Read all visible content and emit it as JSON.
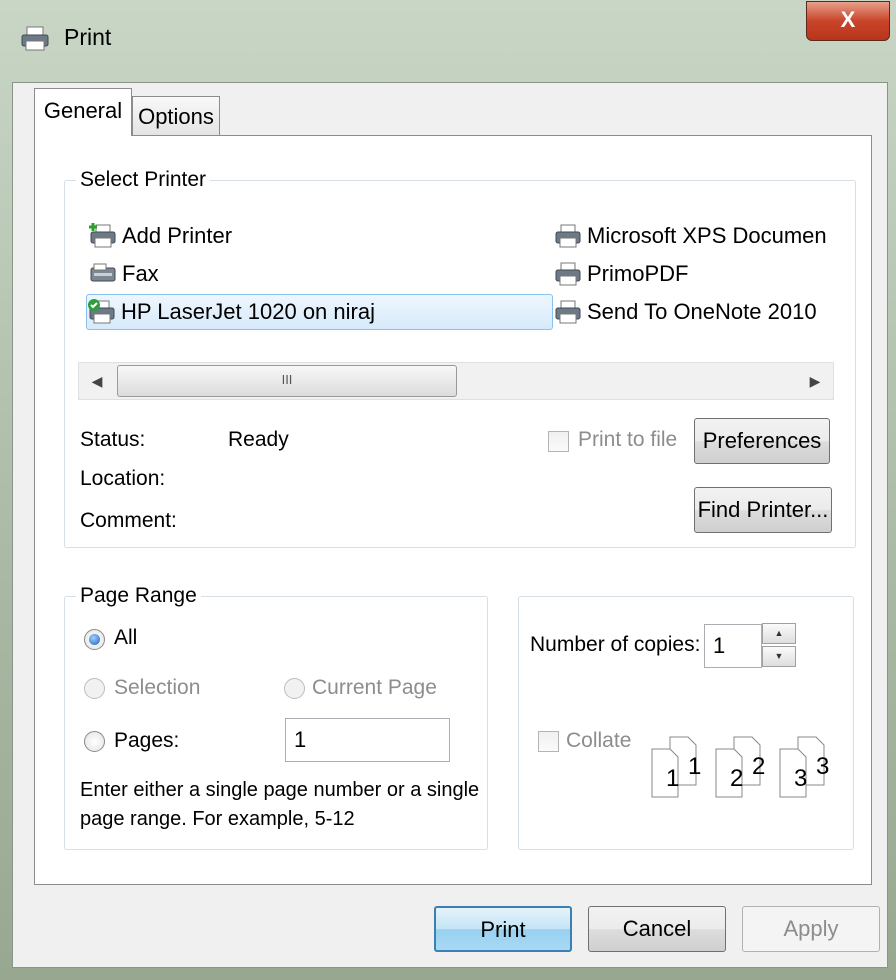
{
  "window": {
    "title": "Print",
    "close_label": "X"
  },
  "tabs": [
    {
      "label": "General",
      "active": true
    },
    {
      "label": "Options",
      "active": false
    }
  ],
  "select_printer": {
    "legend": "Select Printer",
    "printers_left": [
      "Add Printer",
      "Fax",
      "HP LaserJet 1020 on niraj"
    ],
    "printers_right": [
      "Microsoft XPS Documen",
      "PrimoPDF",
      "Send To OneNote 2010"
    ],
    "selected": "HP LaserJet 1020 on niraj",
    "scroll_grip": "III",
    "status_label": "Status:",
    "status_value": "Ready",
    "location_label": "Location:",
    "comment_label": "Comment:",
    "print_to_file": "Print to file",
    "preferences": "Preferences",
    "find_printer": "Find Printer..."
  },
  "page_range": {
    "legend": "Page Range",
    "all": "All",
    "selection": "Selection",
    "current_page": "Current Page",
    "pages": "Pages:",
    "pages_value": "1",
    "hint": "Enter either a single page number or a single page range.  For example, 5-12"
  },
  "copies": {
    "label": "Number of copies:",
    "value": "1",
    "collate": "Collate",
    "collate_pages": [
      "1",
      "2",
      "3"
    ]
  },
  "buttons": {
    "print": "Print",
    "cancel": "Cancel",
    "apply": "Apply"
  },
  "colors": {
    "accent": "#3c7fb1",
    "close": "#c8452a",
    "selection": "#d7eafb"
  }
}
